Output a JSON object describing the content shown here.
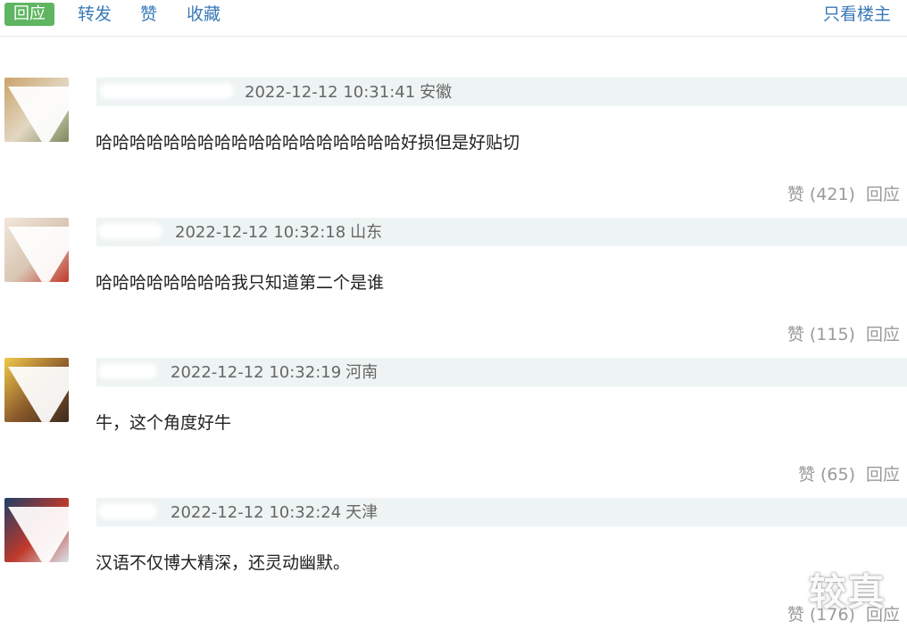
{
  "toolbar": {
    "reply_label": "回应",
    "forward_label": "转发",
    "like_label": "赞",
    "collect_label": "收藏",
    "op_only_label": "只看楼主"
  },
  "comments": [
    {
      "timestamp": "2022-12-12 10:31:41",
      "location": "安徽",
      "text": "哈哈哈哈哈哈哈哈哈哈哈哈哈哈哈哈哈哈好损但是好贴切",
      "like_label": "赞 (421)",
      "reply_label": "回应",
      "avatar_colors": [
        "#c9a36a",
        "#e3d7c3",
        "#7d8a5e"
      ]
    },
    {
      "timestamp": "2022-12-12 10:32:18",
      "location": "山东",
      "text": "哈哈哈哈哈哈哈哈我只知道第二个是谁",
      "like_label": "赞 (115)",
      "reply_label": "回应",
      "avatar_colors": [
        "#f2e6da",
        "#d9c6b4",
        "#c0392b"
      ]
    },
    {
      "timestamp": "2022-12-12 10:32:19",
      "location": "河南",
      "text": "牛，这个角度好牛",
      "like_label": "赞 (65)",
      "reply_label": "回应",
      "avatar_colors": [
        "#f0c94a",
        "#8b5a2b",
        "#3b2a1e"
      ]
    },
    {
      "timestamp": "2022-12-12 10:32:24",
      "location": "天津",
      "text": "汉语不仅博大精深，还灵动幽默。",
      "like_label": "赞 (176)",
      "reply_label": "回应",
      "avatar_colors": [
        "#1f3f66",
        "#c0392b",
        "#d9e4ef"
      ]
    }
  ],
  "watermark": "较真"
}
